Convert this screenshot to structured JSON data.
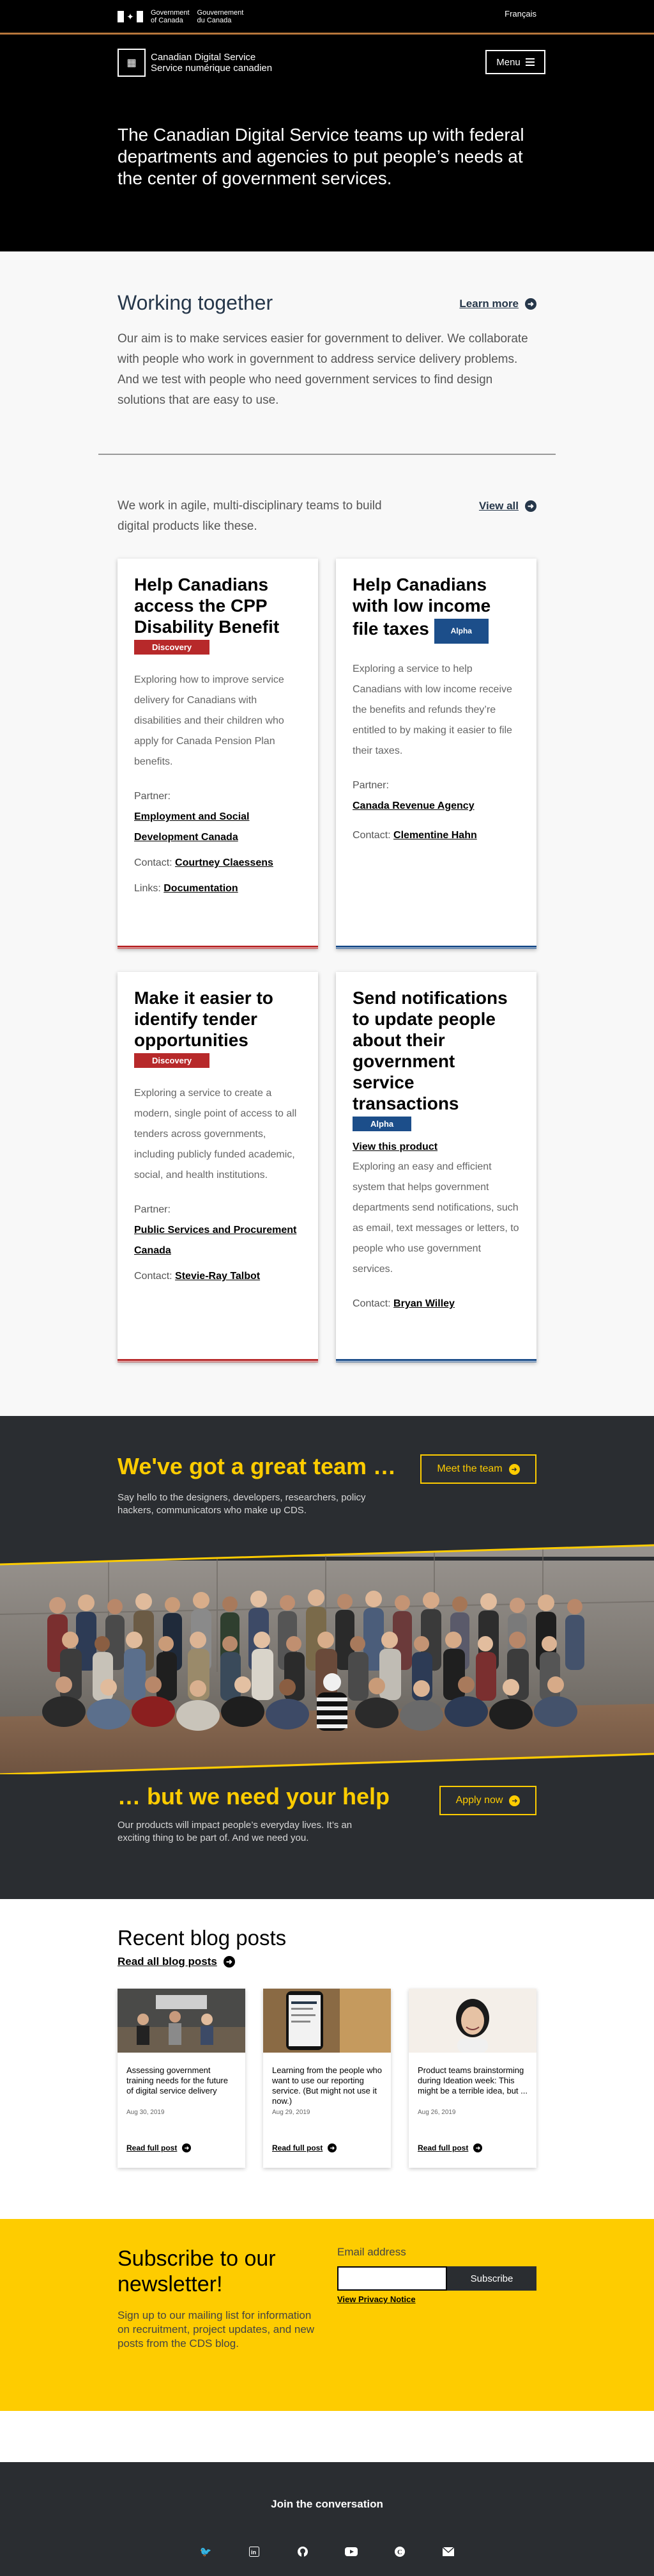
{
  "gov_bar": {
    "gov_name_en": "Government",
    "gov_name_en2": "of Canada",
    "gov_name_fr": "Gouvernement",
    "gov_name_fr2": "du Canada",
    "language_link": "Français",
    "accent_color": "#b7763b"
  },
  "header": {
    "logo_line1": "Canadian Digital Service",
    "logo_line2": "Service numérique canadien",
    "menu_label": "Menu",
    "hero_text": "The Canadian Digital Service teams up with federal departments and agencies to put people’s needs at the center of government services."
  },
  "working": {
    "title": "Working together",
    "learn_more": "Learn more",
    "body": "Our aim is to make services easier for government to deliver. We collaborate with people who work in government to address service delivery problems. And we test with people who need government services to find design solutions that are easy to use."
  },
  "products": {
    "intro": "We work in agile, multi-disciplinary teams to build digital products like these.",
    "view_all": "View all",
    "cards": [
      {
        "title": "Help Canadians access the CPP Disability Benefit",
        "badge": "Discovery",
        "description": "Exploring how to improve service delivery for Canadians with disabilities and their children who apply for Canada Pension Plan benefits.",
        "partner_label": "Partner:",
        "partner": "Employment and Social Development Canada",
        "contact_label": "Contact:",
        "contact": "Courtney Claessens",
        "links_label": "Links:",
        "links": "Documentation"
      },
      {
        "title": "Help Canadians with low income file taxes",
        "badge": "Alpha",
        "description": "Exploring a service to help Canadians with low income receive the benefits and refunds they’re entitled to by making it easier to file their taxes.",
        "partner_label": "Partner:",
        "partner": "Canada Revenue Agency",
        "contact_label": "Contact:",
        "contact": "Clementine Hahn"
      },
      {
        "title": "Make it easier to identify tender opportunities",
        "badge": "Discovery",
        "description": "Exploring a service to create a modern, single point of access to all tenders across governments, including publicly funded academic, social, and health institutions.",
        "partner_label": "Partner:",
        "partner": "Public Services and Procurement Canada",
        "contact_label": "Contact:",
        "contact": "Stevie-Ray Talbot"
      },
      {
        "title": "Send notifications to update people about their government service transactions",
        "badge": "Alpha",
        "view_product": "View this product",
        "description": "Exploring an easy and efficient system that helps government departments send notifications, such as email, text messages or letters, to people who use government services.",
        "contact_label": "Contact:",
        "contact": "Bryan Willey"
      }
    ]
  },
  "team": {
    "title": "We've got a great team …",
    "subtitle": "Say hello to the designers, developers, researchers, policy hackers, communicators who make up CDS.",
    "meet_button": "Meet the team",
    "help_title": "… but we need your help",
    "help_subtitle": "Our products will impact people’s everyday lives. It’s an exciting thing to be part of. And we need you.",
    "apply_button": "Apply now",
    "accent_color": "#fecc00"
  },
  "blog": {
    "title": "Recent blog posts",
    "read_all": "Read all blog posts",
    "posts": [
      {
        "title": "Assessing government training needs for the future of digital service delivery",
        "date": "Aug 30, 2019",
        "read": "Read full post"
      },
      {
        "title": "Learning from the people who want to use our reporting service. (But might not use it now.)",
        "date": "Aug 29, 2019",
        "read": "Read full post"
      },
      {
        "title": "Product teams brainstorming during Ideation week: This might be a terrible idea, but ...",
        "date": "Aug 26, 2019",
        "read": "Read full post"
      }
    ]
  },
  "newsletter": {
    "title": "Subscribe to our newsletter!",
    "subtitle": "Sign up to our mailing list for information on recruitment, project updates, and new posts from the CDS blog.",
    "email_label": "Email address",
    "email_value": "",
    "subscribe_button": "Subscribe",
    "privacy_link": "View Privacy Notice"
  },
  "footer": {
    "join": "Join the conversation",
    "social": [
      "twitter-icon",
      "linkedin-icon",
      "github-icon",
      "youtube-icon",
      "blog-icon",
      "email-icon"
    ]
  }
}
